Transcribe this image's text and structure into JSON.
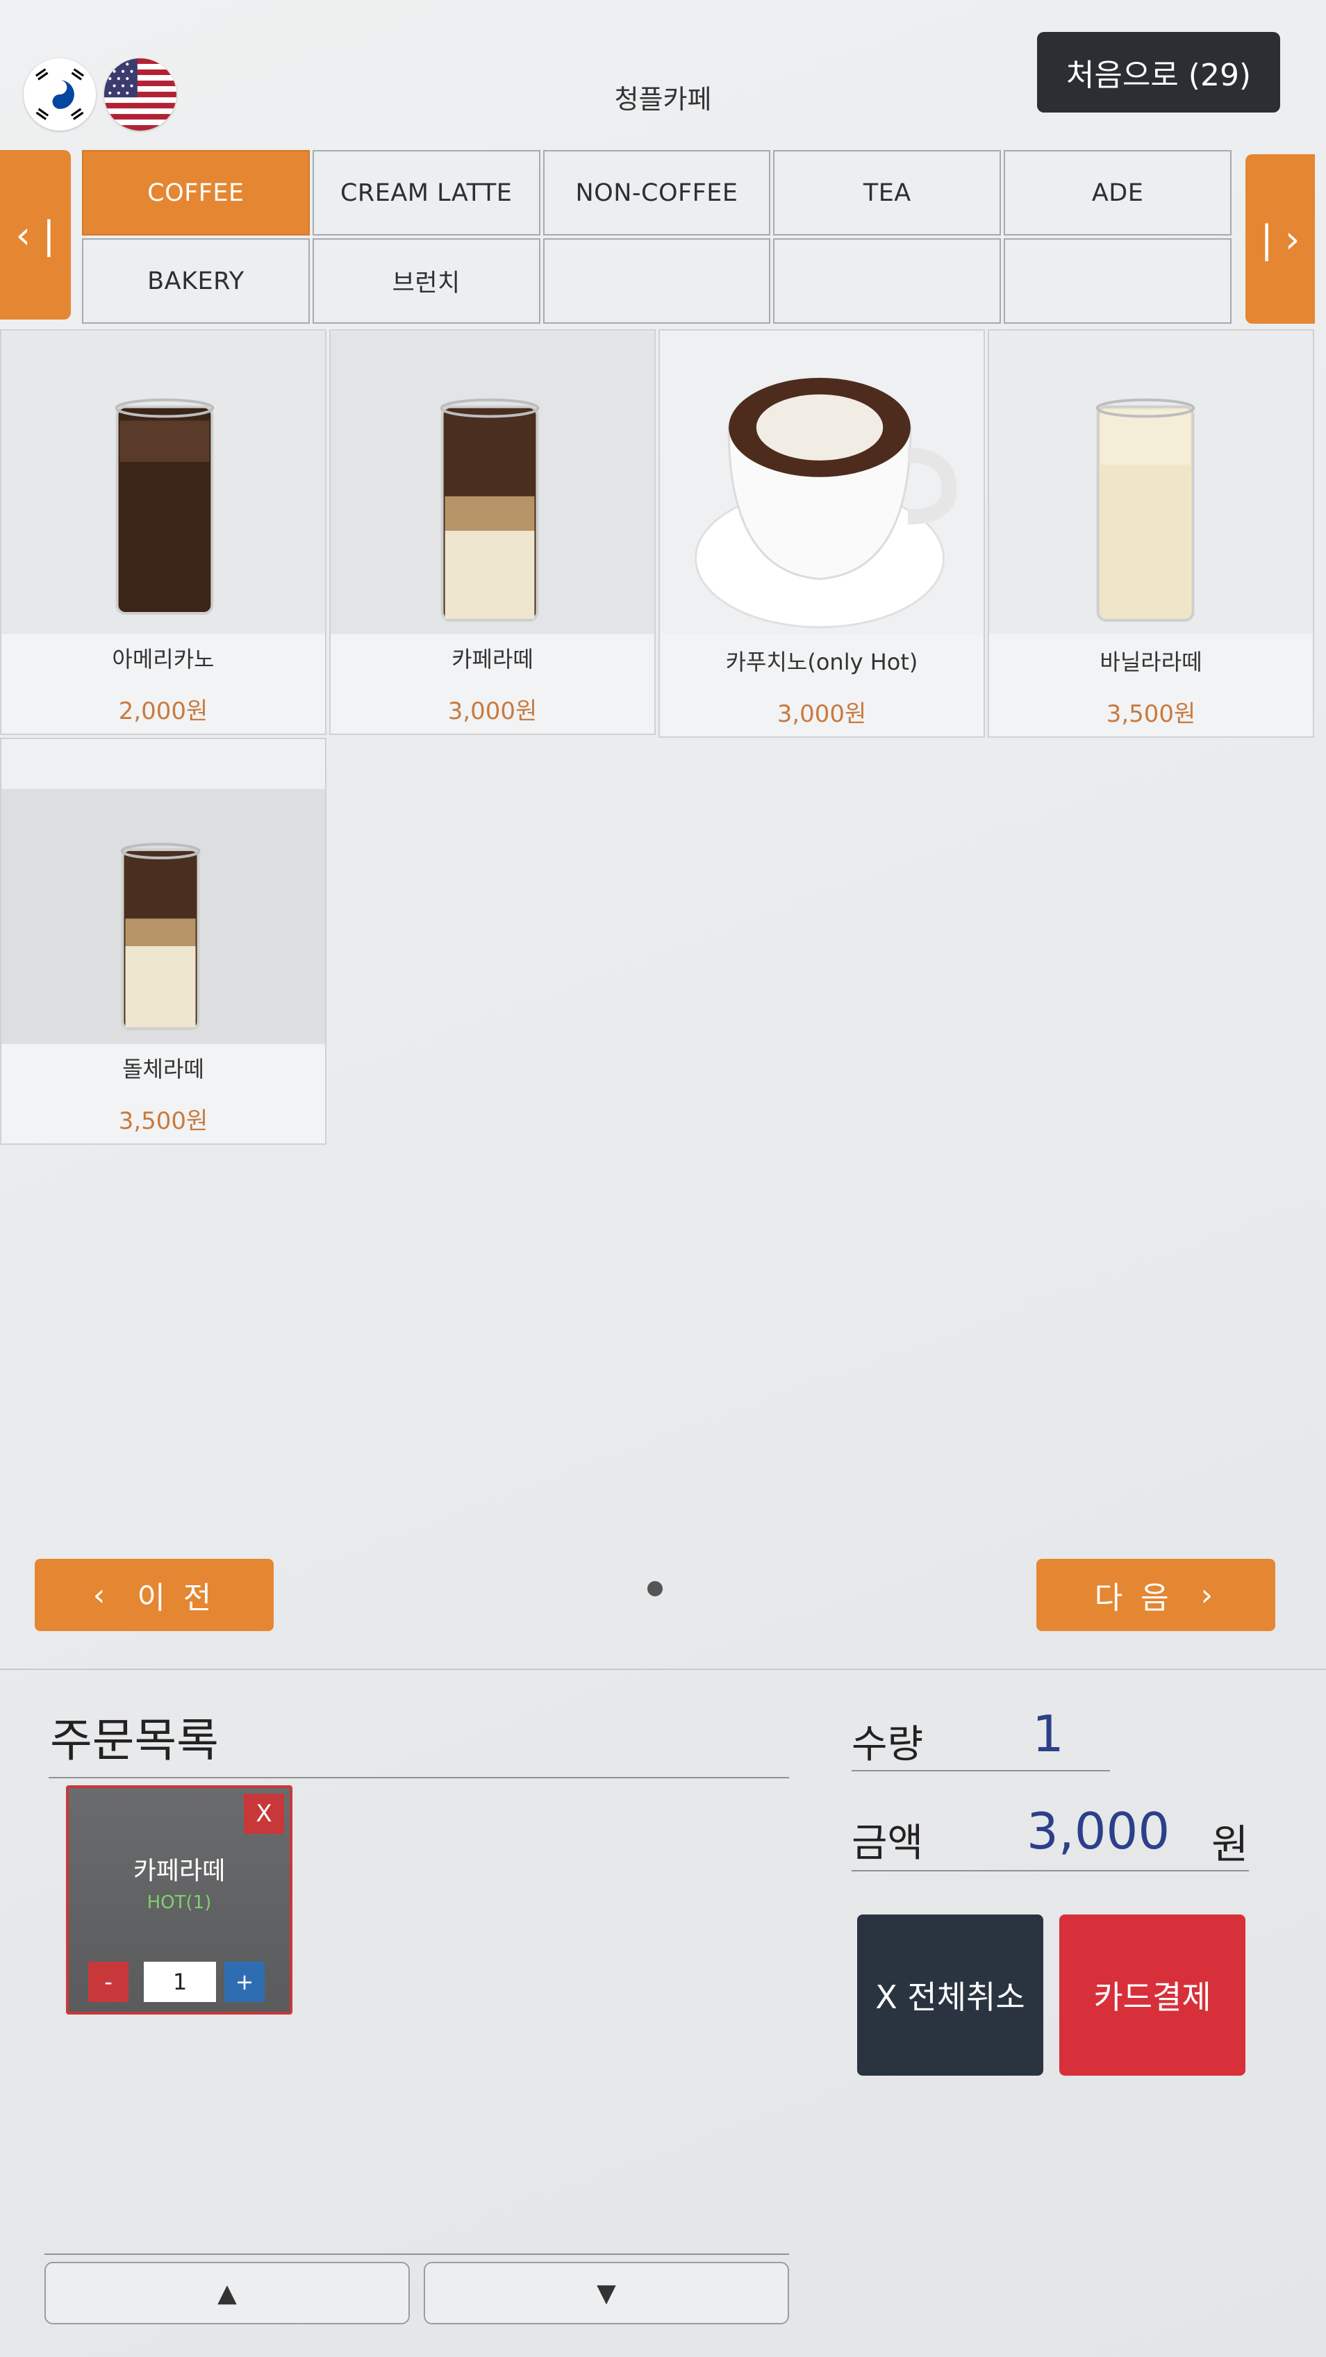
{
  "header": {
    "store_name": "청플카페",
    "home_button_label": "처음으로 (29)",
    "languages": [
      {
        "code": "ko",
        "icon": "korea-flag-icon"
      },
      {
        "code": "en",
        "icon": "usa-flag-icon"
      }
    ]
  },
  "categories": {
    "prev_icon": "chevron-left-icon",
    "next_icon": "chevron-right-icon",
    "tabs": [
      "COFFEE",
      "CREAM LATTE",
      "NON-COFFEE",
      "TEA",
      "ADE",
      "BAKERY",
      "브런치",
      "",
      "",
      ""
    ],
    "active_index": 0
  },
  "products": [
    {
      "name": "아메리카노",
      "price": "2,000원"
    },
    {
      "name": "카페라떼",
      "price": "3,000원"
    },
    {
      "name": "카푸치노(only Hot)",
      "price": "3,000원"
    },
    {
      "name": "바닐라라떼",
      "price": "3,500원"
    },
    {
      "name": "돌체라떼",
      "price": "3,500원"
    }
  ],
  "pagination": {
    "prev_label": "이 전",
    "next_label": "다 음",
    "current_page": 1,
    "total_pages": 1
  },
  "order": {
    "title": "주문목록",
    "items": [
      {
        "name": "카페라떼",
        "option": "HOT(1)",
        "quantity": "1",
        "remove_label": "X",
        "minus_label": "-",
        "plus_label": "+"
      }
    ]
  },
  "summary": {
    "qty_label": "수량",
    "qty_value": "1",
    "amount_label": "금액",
    "amount_value": "3,000",
    "amount_unit": "원"
  },
  "actions": {
    "cancel_all_label": "X 전체취소",
    "pay_card_label": "카드결제"
  },
  "colors": {
    "accent": "#e58632",
    "dark": "#2b2f33",
    "danger": "#d7303a",
    "price": "#c97a3e",
    "amount": "#2c3f8a"
  }
}
